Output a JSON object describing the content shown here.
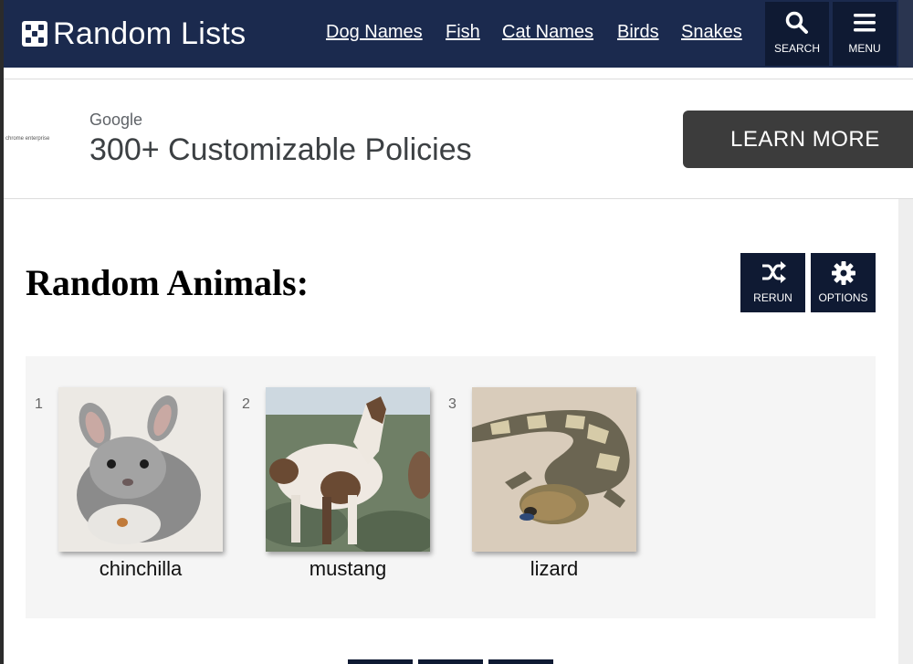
{
  "header": {
    "logo_text": "Random Lists",
    "nav": [
      "Dog Names",
      "Fish",
      "Cat Names",
      "Birds",
      "Snakes"
    ],
    "search_label": "SEARCH",
    "menu_label": "MENU"
  },
  "ad": {
    "tiny_text": "chrome enterprise",
    "brand": "Google",
    "headline": "300+ Customizable Policies",
    "cta": "LEARN MORE"
  },
  "section": {
    "title": "Random Animals:",
    "rerun_label": "RERUN",
    "options_label": "OPTIONS"
  },
  "animals": [
    {
      "number": "1",
      "name": "chinchilla"
    },
    {
      "number": "2",
      "name": "mustang"
    },
    {
      "number": "3",
      "name": "lizard"
    }
  ],
  "colors": {
    "header_bg": "#1b2a4e",
    "button_bg": "#0f1a33",
    "ad_button_bg": "#3c3c3c",
    "panel_bg": "#f5f5f5"
  }
}
